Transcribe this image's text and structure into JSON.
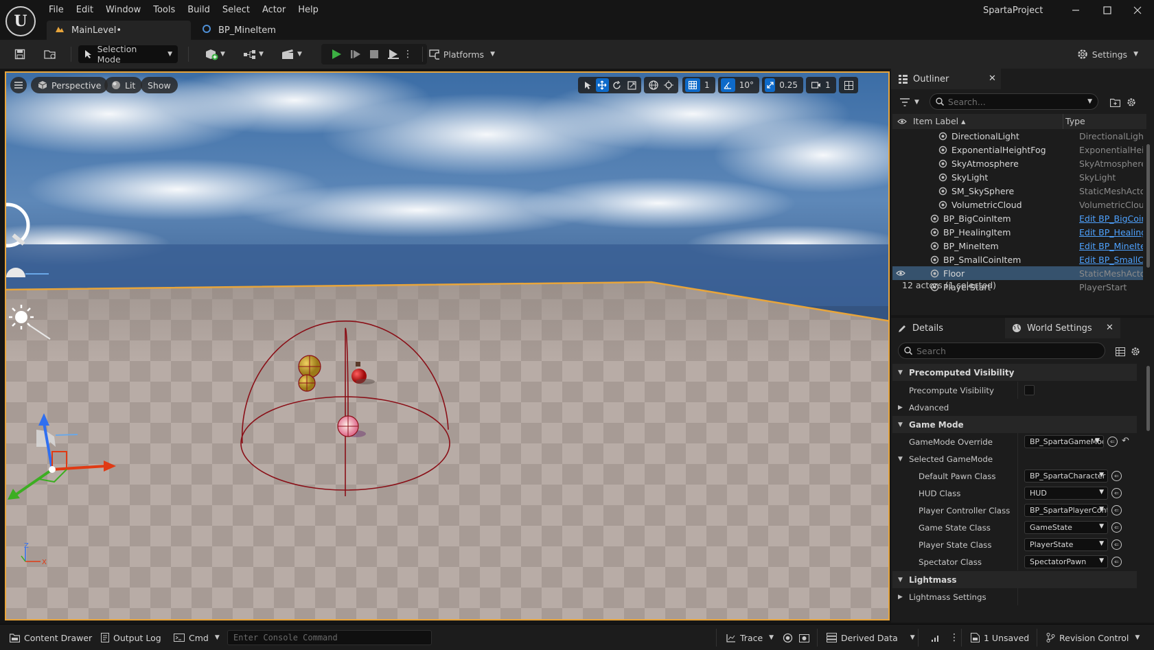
{
  "app": {
    "logo_text": "U",
    "project_name": "SpartaProject",
    "menu": [
      "File",
      "Edit",
      "Window",
      "Tools",
      "Build",
      "Select",
      "Actor",
      "Help"
    ],
    "tabs": [
      {
        "label": "MainLevel•",
        "icon": "level-icon",
        "active": true
      },
      {
        "label": "BP_MineItem",
        "icon": "blueprint-icon",
        "active": false
      }
    ],
    "window_controls": [
      "minimize",
      "maximize",
      "close"
    ]
  },
  "toolbar": {
    "selection_mode_label": "Selection Mode",
    "platforms_label": "Platforms",
    "settings_label": "Settings"
  },
  "viewport": {
    "perspective_label": "Perspective",
    "lit_label": "Lit",
    "show_label": "Show",
    "grid_snap_value": "1",
    "rotation_snap_value": "10°",
    "scale_snap_value": "0.25",
    "camera_speed_value": "1",
    "axis_x_label": "X",
    "axis_z_label": "Z"
  },
  "outliner": {
    "tab_label": "Outliner",
    "search_placeholder": "Search...",
    "col_label": "Item Label ▴",
    "col_type": "Type",
    "rows": [
      {
        "name": "DirectionalLight",
        "type": "DirectionalLight",
        "link": false,
        "indent": 2,
        "icon": "directional-light-icon",
        "selected": false
      },
      {
        "name": "ExponentialHeightFog",
        "type": "ExponentialHeightFog",
        "link": false,
        "indent": 2,
        "icon": "fog-icon",
        "selected": false
      },
      {
        "name": "SkyAtmosphere",
        "type": "SkyAtmosphere",
        "link": false,
        "indent": 2,
        "icon": "sky-atmosphere-icon",
        "selected": false
      },
      {
        "name": "SkyLight",
        "type": "SkyLight",
        "link": false,
        "indent": 2,
        "icon": "sky-light-icon",
        "selected": false
      },
      {
        "name": "SM_SkySphere",
        "type": "StaticMeshActor",
        "link": false,
        "indent": 2,
        "icon": "static-mesh-icon",
        "selected": false
      },
      {
        "name": "VolumetricCloud",
        "type": "VolumetricCloud",
        "link": false,
        "indent": 2,
        "icon": "cloud-icon",
        "selected": false
      },
      {
        "name": "BP_BigCoinItem",
        "type": "Edit BP_BigCoinItem",
        "link": true,
        "indent": 1,
        "icon": "actor-icon",
        "selected": false
      },
      {
        "name": "BP_HealingItem",
        "type": "Edit BP_HealingItem",
        "link": true,
        "indent": 1,
        "icon": "actor-icon",
        "selected": false
      },
      {
        "name": "BP_MineItem",
        "type": "Edit BP_MineItem",
        "link": true,
        "indent": 1,
        "icon": "actor-icon",
        "selected": false
      },
      {
        "name": "BP_SmallCoinItem",
        "type": "Edit BP_SmallCoinItem",
        "link": true,
        "indent": 1,
        "icon": "actor-icon",
        "selected": false
      },
      {
        "name": "Floor",
        "type": "StaticMeshActor",
        "link": false,
        "indent": 1,
        "icon": "static-mesh-icon",
        "selected": true
      },
      {
        "name": "PlayerStart",
        "type": "PlayerStart",
        "link": false,
        "indent": 1,
        "icon": "player-start-icon",
        "selected": false
      }
    ],
    "status": "12 actors (1 selected)"
  },
  "details": {
    "details_tab_label": "Details",
    "world_settings_tab_label": "World Settings",
    "search_placeholder": "Search",
    "sections": {
      "precomputed_visibility": "Precomputed Visibility",
      "precompute_visibility": "Precompute Visibility",
      "advanced": "Advanced",
      "game_mode": "Game Mode",
      "gamemode_override": "GameMode Override",
      "gamemode_override_value": "BP_SpartaGameMode",
      "selected_gamemode": "Selected GameMode",
      "lightmass": "Lightmass",
      "lightmass_settings": "Lightmass Settings"
    },
    "selected_gamemode_props": [
      {
        "label": "Default Pawn Class",
        "value": "BP_SpartaCharacter"
      },
      {
        "label": "HUD Class",
        "value": "HUD"
      },
      {
        "label": "Player Controller Class",
        "value": "BP_SpartaPlayerController"
      },
      {
        "label": "Game State Class",
        "value": "GameState"
      },
      {
        "label": "Player State Class",
        "value": "PlayerState"
      },
      {
        "label": "Spectator Class",
        "value": "SpectatorPawn"
      }
    ]
  },
  "statusbar": {
    "content_drawer": "Content Drawer",
    "output_log": "Output Log",
    "cmd": "Cmd",
    "console_placeholder": "Enter Console Command",
    "trace": "Trace",
    "derived_data": "Derived Data",
    "unsaved": "1 Unsaved",
    "revision_control": "Revision Control"
  },
  "colors": {
    "accent_blue": "#0e6ac9",
    "selection_row": "#36526d",
    "link_blue": "#4ea2ff",
    "viewport_border": "#e8a53b",
    "play_green": "#3cb043"
  }
}
